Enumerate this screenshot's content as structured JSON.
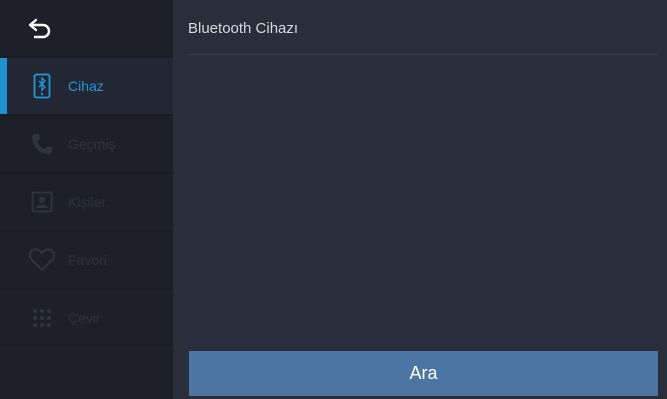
{
  "header": {
    "title": "Bluetooth Cihazı"
  },
  "sidebar": {
    "back_icon": "back-arrow-icon",
    "items": [
      {
        "label": "Cihaz",
        "icon": "bluetooth-phone-icon",
        "state": "active"
      },
      {
        "label": "Geçmiş",
        "icon": "phone-icon",
        "state": "disabled"
      },
      {
        "label": "Kişiler",
        "icon": "contact-icon",
        "state": "disabled"
      },
      {
        "label": "Favori",
        "icon": "heart-icon",
        "state": "disabled"
      },
      {
        "label": "Çevir",
        "icon": "dialpad-icon",
        "state": "disabled"
      }
    ]
  },
  "main": {
    "search_button_label": "Ara"
  },
  "colors": {
    "accent": "#1e93d0",
    "button": "#4d75a4",
    "sidebar_bg": "#1d2029",
    "main_bg": "#2a2d3a"
  }
}
